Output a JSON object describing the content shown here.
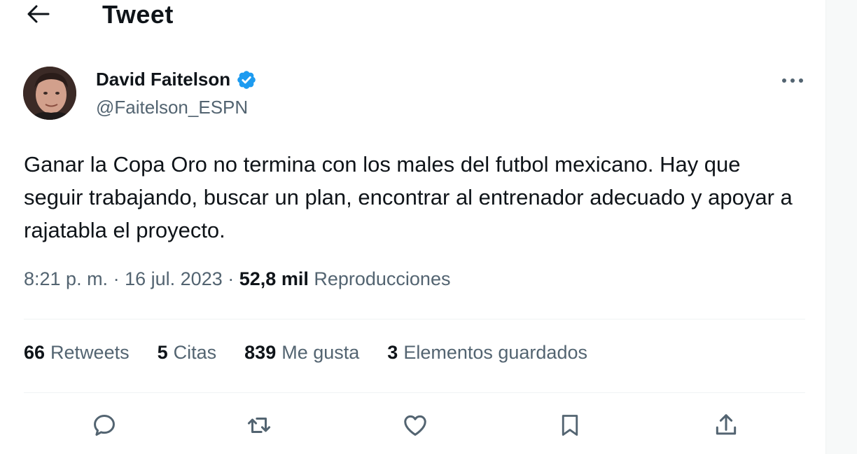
{
  "header": {
    "title": "Tweet",
    "back_icon": "arrow-left-icon"
  },
  "author": {
    "name": "David Faitelson",
    "handle": "@Faitelson_ESPN",
    "verified_icon": "verified-badge-icon",
    "verified_color": "#1d9bf0"
  },
  "tweet": {
    "text": "Ganar la Copa Oro no termina con los males del futbol mexicano. Hay que seguir trabajando, buscar un plan, encontrar al entrenador adecuado y apoyar a rajatabla el proyecto.",
    "time": "8:21 p. m.",
    "separator": "·",
    "date": "16 jul. 2023",
    "views_count": "52,8 mil",
    "views_label": "Reproducciones"
  },
  "stats": [
    {
      "count": "66",
      "label": "Retweets"
    },
    {
      "count": "5",
      "label": "Citas"
    },
    {
      "count": "839",
      "label": "Me gusta"
    },
    {
      "count": "3",
      "label": "Elementos guardados"
    }
  ],
  "actions": [
    {
      "icon": "reply-icon"
    },
    {
      "icon": "retweet-icon"
    },
    {
      "icon": "like-icon"
    },
    {
      "icon": "bookmark-icon"
    },
    {
      "icon": "share-icon"
    }
  ],
  "colors": {
    "text_primary": "#0f1419",
    "text_secondary": "#536471",
    "divider": "#eff3f4"
  }
}
